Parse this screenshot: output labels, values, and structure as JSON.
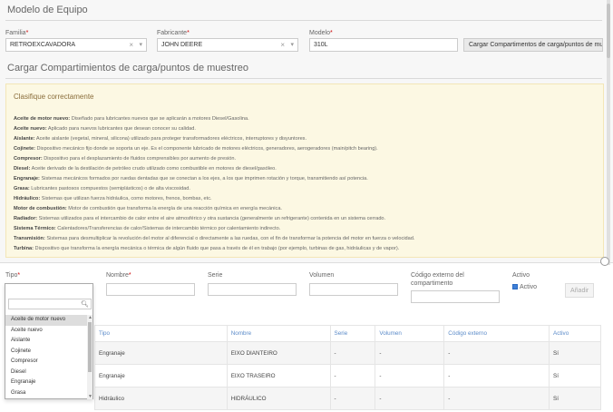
{
  "header": {
    "title": "Modelo de Equipo"
  },
  "filters": {
    "familia": {
      "label": "Familia",
      "value": "RETROEXCAVADORA"
    },
    "fabricante": {
      "label": "Fabricante",
      "value": "JOHN DEERE"
    },
    "modelo": {
      "label": "Modelo",
      "value": "310L"
    },
    "load_button": "Cargar Compartimentos de carga/puntos de muestreo",
    "required_mark": "*",
    "clear_glyph": "×",
    "caret_glyph": "▾"
  },
  "section": {
    "title": "Cargar Compartimientos de carga/puntos de muestreo"
  },
  "notice": {
    "title": "Clasifique correctamente",
    "items": [
      {
        "term": "Aceite de motor nuevo:",
        "desc": " Diseñado para lubricantes nuevos que se aplicarán a motores Diesel/Gasolina."
      },
      {
        "term": "Aceite nuevo:",
        "desc": " Aplicado para nuevos lubricantes que desean conocer su calidad."
      },
      {
        "term": "Aislante:",
        "desc": " Aceite aislante (vegetal, mineral, silicona) utilizado para proteger transformadores eléctricos, interruptores y disyuntores."
      },
      {
        "term": "Cojinete:",
        "desc": " Dispositivo mecánico fijo donde se soporta un eje. Es el componente lubricado de motores eléctricos, generadores, aerogeradores (main/pitch bearing)."
      },
      {
        "term": "Compresor:",
        "desc": " Dispositivo para el desplazamiento de fluidos comprensibles por aumento de presión."
      },
      {
        "term": "Diesel:",
        "desc": " Aceite derivado de la destilación de petróleo crudo utilizado como combustible en motores de diesel/gasóleo."
      },
      {
        "term": "Engranaje:",
        "desc": " Sistemas mecánicos formados por ruedas dentadas que se conectan a los ejes, a los que imprimen rotación y torque, transmitiendo así potencia."
      },
      {
        "term": "Grasa:",
        "desc": " Lubricantes pastosos compuestos (semiplásticos) o de alta viscosidad."
      },
      {
        "term": "Hidráulico:",
        "desc": " Sistemas que utilizan fuerza hidráulica, como motores, frenos, bombas, etc."
      },
      {
        "term": "Motor de combustión:",
        "desc": " Motor de combustión que transforma la energía de una reacción química en energía mecánica."
      },
      {
        "term": "Radiador:",
        "desc": " Sistemas utilizados para el intercambio de calor entre el aire atmosférico y otra sustancia (generalmente un refrigerante) contenida en un sistema cerrado."
      },
      {
        "term": "Sistema Térmico:",
        "desc": " Calentadores/Transferencias de calor/Sistemas de intercambio térmico por calentamiento indirecto."
      },
      {
        "term": "Transmisión:",
        "desc": " Sistemas para desmultiplicar la revolución del motor al diferencial o directamente a las ruedas, con el fin de transformar la potencia del motor en fuerza o velocidad."
      },
      {
        "term": "Turbina:",
        "desc": " Dispositivo que transforma la energía mecánica o térmica de algún fluido que pasa a través de él en trabajo (por ejemplo, turbinas de gas, hidráulicas y de vapor)."
      }
    ]
  },
  "form": {
    "tipo_label": "Tipo",
    "nombre_label": "Nombre",
    "serie_label": "Serie",
    "volumen_label": "Volumen",
    "codigo_label_1": "Código externo del",
    "codigo_label_2": "compartimento",
    "activo_label": "Activo",
    "activo_check_label": "Activo",
    "activo_checked": true,
    "add_button": "Añadir"
  },
  "dropdown": {
    "search_icon": "magnifier-icon",
    "options": [
      "Aceite de motor nuevo",
      "Aceite nuevo",
      "Aislante",
      "Cojinete",
      "Compresor",
      "Diesel",
      "Engranaje",
      "Grasa"
    ],
    "selected_index": 0
  },
  "table": {
    "columns": [
      "Tipo",
      "Nombre",
      "Serie",
      "Volumen",
      "Código externo",
      "Activo"
    ],
    "rows": [
      [
        "Engranaje",
        "EIXO DIANTEIRO",
        "-",
        "-",
        "-",
        "Sí"
      ],
      [
        "Engranaje",
        "EIXO TRASEIRO",
        "-",
        "-",
        "-",
        "Sí"
      ],
      [
        "Hidráulico",
        "HIDRÁULICO",
        "-",
        "-",
        "-",
        "Sí"
      ]
    ]
  },
  "colors": {
    "notice_bg": "#fcf8e3",
    "table_header_text": "#5b8bc9",
    "required": "#cc0000"
  }
}
